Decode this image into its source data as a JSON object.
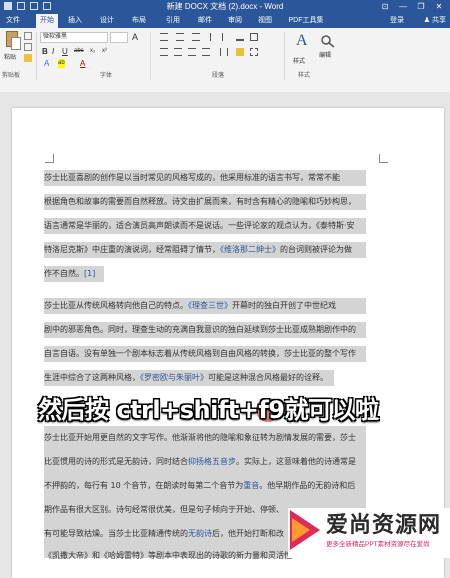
{
  "window": {
    "title": "新建 DOCX 文档 (2).docx - Word",
    "controls": [
      "⊡",
      "—",
      "❐",
      "✕"
    ]
  },
  "tabs": [
    "文件",
    "开始",
    "插入",
    "设计",
    "布局",
    "引用",
    "邮件",
    "审阅",
    "视图",
    "PDF工具集"
  ],
  "active_tab": "开始",
  "signin": "登录",
  "share": "♟ 共享",
  "ribbon": {
    "font_name": "微软雅黑",
    "font_size": "",
    "groups": [
      "剪贴板",
      "字体",
      "段落",
      "样式"
    ],
    "paste_label": "粘贴",
    "styles_label": "样式",
    "edit_label": "编辑",
    "format_glyphs": {
      "bold": "B",
      "italic": "I",
      "underline": "U",
      "strike": "abc",
      "sub": "x₂",
      "sup": "x²",
      "font_color": "A",
      "highlight": "ab",
      "grow": "A",
      "styles_icon": "A"
    }
  },
  "document": {
    "lines": [
      "莎士比亚喜剧的创作是以当时常见的风格写成的，他采用标准的语言书写，常常不能",
      "根据角色和故事的需要而自然释放。诗文由扩展而来，有时含有精心的隐喻和巧妙构思，",
      "语言通常是华丽的，适合演员高声朗读而不是说话。一些评论家的观点认为，《泰特斯·安",
      "特洛尼克斯》中庄重的演说词，经常阻碍了情节，《维洛那二绅士》的台词则被评论为做",
      "作不自然。",
      "莎士比亚从传统风格转向他自己的特点。《理查三世》开幕时的独白开创了中世纪戏",
      "剧中的邪恶角色。同时，理查生动的充满自我意识的独白延续到莎士比亚成熟期剧作中的",
      "自言自语。没有单独一个剧本标志着从传统风格到自由风格的转换，莎士比亚的整个写作",
      "生涯中综合了这两种风格，《罗密欧与朱丽叶》可能是这种混合风格最好的诠释。",
      "莎士比亚开始用更自然的文字写作。他渐渐将他的隐喻和象征转为剧情发展的需要，莎士",
      "比亚惯用的诗的形式是无韵诗，同时结合抑扬格五音步。实际上，这意味着他的诗通常是",
      "不押韵的，每行有 10 个音节，在朗读时每第二个音节为重音。他早期作品的无韵诗和后",
      "期作品有很大区别。诗句经常很优美，但是句子倾向于开始、停顿、",
      "有可能导致枯燥。当莎士比亚精通传统的无韵诗后，他开始打断和改",
      "《凯撒大帝》和《哈姆雷特》等剧本中表现出的诗歌的新力量和灵活性"
    ],
    "links": [
      "《泰特斯·安特洛尼克斯》",
      "《维洛那二绅士》",
      "《理查三世》",
      "《罗密欧与朱丽叶》",
      "无韵诗",
      "抑扬格五音步",
      "重音"
    ],
    "note_marker": "[1]"
  },
  "caption": "然后按 ctrl+shift+f9就可以啦",
  "watermark": {
    "title": "爱尚资源网",
    "subtitle": "更多全新精品PPT素材资源尽在爱尚"
  },
  "colors": {
    "brand": "#2b579a",
    "selection": "#d4d4d4",
    "link": "#2b579a",
    "cursor": "#cd4646",
    "watermark_red": "#e0245a"
  }
}
